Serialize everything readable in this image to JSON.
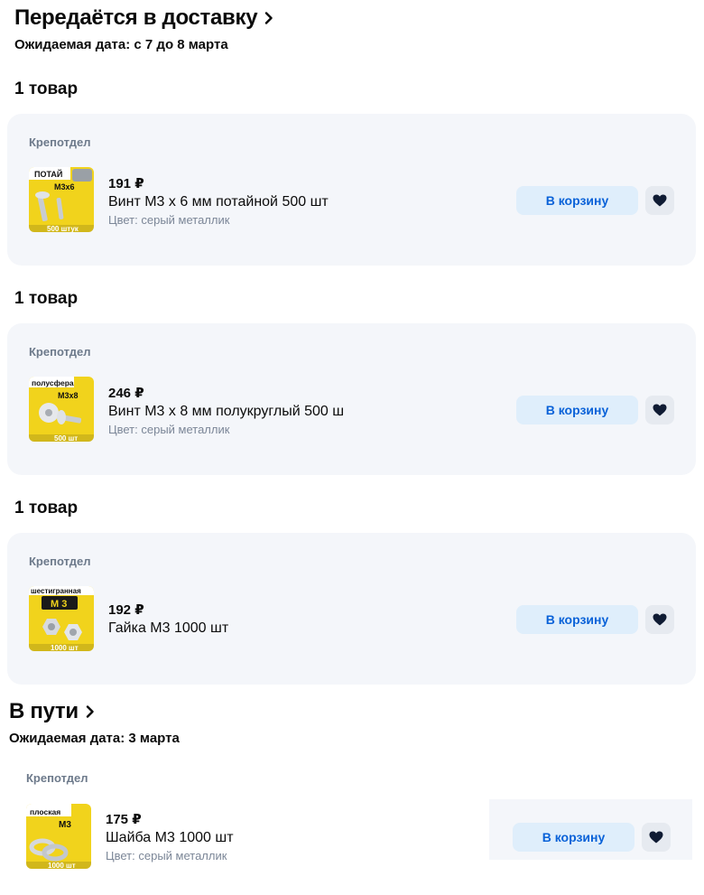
{
  "sections": [
    {
      "title": "Передаётся в доставку",
      "date": "Ожидаемая дата: с 7 до 8 марта"
    },
    {
      "title": "В пути",
      "date": "Ожидаемая дата: 3 марта"
    }
  ],
  "groups": [
    {
      "count": "1 товар",
      "seller": "Крепотдел",
      "price": "191 ₽",
      "name": "Винт М3 х 6 мм потайной 500 шт",
      "color": "Цвет: серый металлик",
      "cart_label": "В корзину",
      "thumb": {
        "top": "ПОТАЙ",
        "code": "M3x6",
        "bottom": "500 штук"
      }
    },
    {
      "count": "1 товар",
      "seller": "Крепотдел",
      "price": "246 ₽",
      "name": "Винт М3 х 8 мм полукруглый 500 ш",
      "color": "Цвет: серый металлик",
      "cart_label": "В корзину",
      "thumb": {
        "top": "полусфера",
        "code": "M3x8",
        "bottom": "500 шт"
      }
    },
    {
      "count": "1 товар",
      "seller": "Крепотдел",
      "price": "192 ₽",
      "name": "Гайка М3 1000 шт",
      "cart_label": "В корзину",
      "thumb": {
        "top": "шестигранная",
        "code": "М 3",
        "bottom": "1000 шт"
      }
    },
    {
      "seller": "Крепотдел",
      "price": "175 ₽",
      "name": "Шайба М3 1000 шт",
      "color": "Цвет: серый металлик",
      "cart_label": "В корзину",
      "thumb": {
        "top": "плоская",
        "code": "М3",
        "bottom": "1000 шт"
      }
    }
  ],
  "colors": {
    "card_bg": "#f4f6fa",
    "cart_bg": "#dfeefb",
    "cart_text": "#0a62d8",
    "thumb_yellow": "#f1d31c"
  },
  "icons": {
    "section_link": "chevron-right-icon",
    "favorite": "heart-icon"
  }
}
